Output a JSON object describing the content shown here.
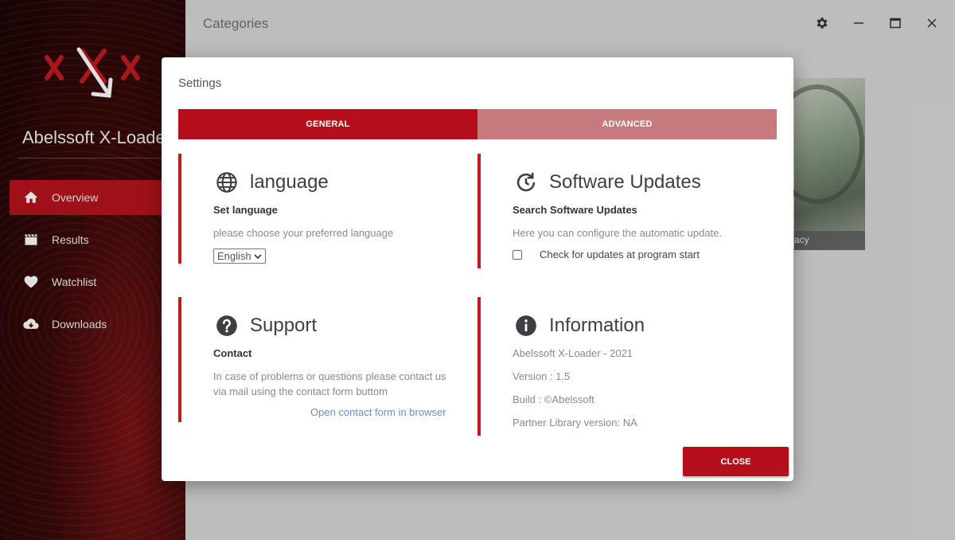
{
  "app": {
    "title": "Abelssoft X-Loader"
  },
  "sidebar": {
    "items": [
      {
        "label": "Overview",
        "icon": "home-icon",
        "active": true
      },
      {
        "label": "Results",
        "icon": "clapperboard-icon",
        "active": false
      },
      {
        "label": "Watchlist",
        "icon": "heart-icon",
        "active": false
      },
      {
        "label": "Downloads",
        "icon": "cloud-download-icon",
        "active": false
      }
    ]
  },
  "main": {
    "title": "Categories",
    "card_caption": "acy"
  },
  "dialog": {
    "title": "Settings",
    "tabs": [
      {
        "label": "GENERAL",
        "active": true
      },
      {
        "label": "ADVANCED",
        "active": false
      }
    ],
    "language": {
      "heading": "language",
      "subheading": "Set language",
      "text": "please choose your preferred language",
      "selected": "English"
    },
    "updates": {
      "heading": "Software Updates",
      "subheading": "Search Software Updates",
      "text": "Here you can configure the automatic update.",
      "checkbox_label": "Check for updates at program start",
      "checked": false
    },
    "support": {
      "heading": "Support",
      "subheading": "Contact",
      "text_line1": "In case of problems or questions please contact us",
      "text_line2": "via mail using the contact form buttom",
      "link": "Open contact form in browser"
    },
    "information": {
      "heading": "Information",
      "lines": [
        "Abelssoft X-Loader - 2021",
        "Version : 1.5",
        "Build : ©Abelssoft",
        "Partner Library version: NA"
      ]
    },
    "close_label": "CLOSE"
  },
  "colors": {
    "accent": "#b5101a",
    "tab_inactive": "#c77a7d",
    "section_border": "#c31a22",
    "link": "#6b8fbf"
  }
}
